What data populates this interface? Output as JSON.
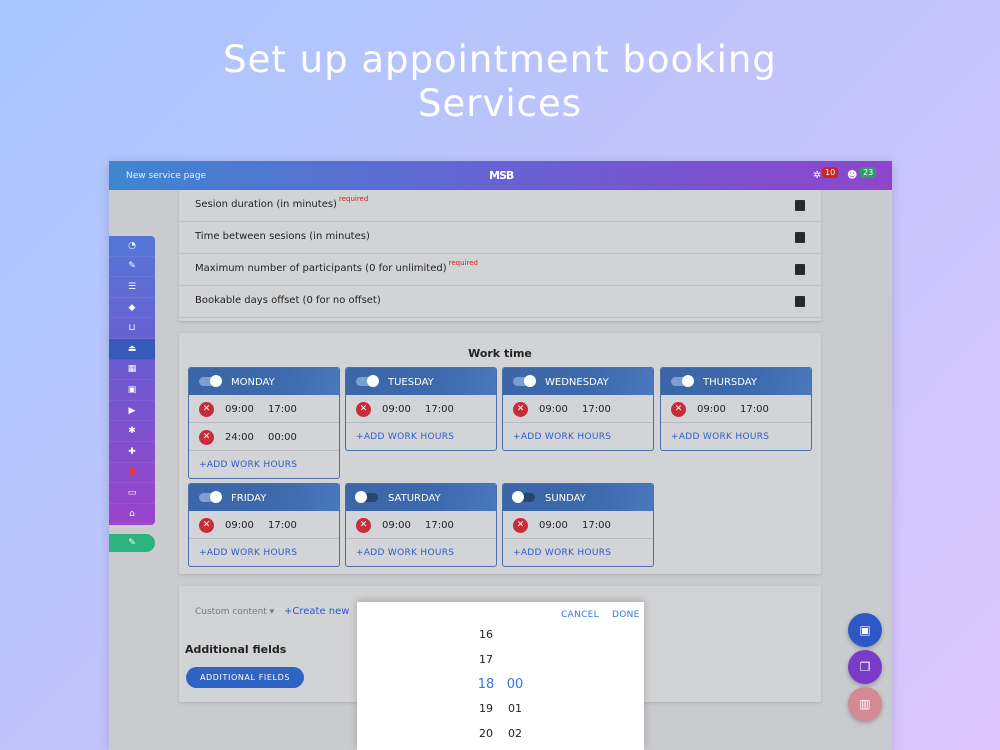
{
  "headline": {
    "line1": "Set up appointment booking",
    "line2": "Services"
  },
  "topbar": {
    "breadcrumb": "New service page",
    "logo": "MSB",
    "notifications_count": "10",
    "users_count": "23"
  },
  "sidebar": {
    "items": [
      {
        "icon": "dashboard-icon",
        "glyph": "◔"
      },
      {
        "icon": "wrench-icon",
        "glyph": "✎"
      },
      {
        "icon": "list-icon",
        "glyph": "☰"
      },
      {
        "icon": "box-icon",
        "glyph": "◆"
      },
      {
        "icon": "cart-icon",
        "glyph": "⊔"
      },
      {
        "icon": "service-bell-icon",
        "glyph": "⏏"
      },
      {
        "icon": "calendar-icon",
        "glyph": "▦"
      },
      {
        "icon": "gift-icon",
        "glyph": "▣"
      },
      {
        "icon": "video-icon",
        "glyph": "▶"
      },
      {
        "icon": "gear-icon",
        "glyph": "✱"
      },
      {
        "icon": "add-user-icon",
        "glyph": "✚"
      },
      {
        "icon": "alert-icon",
        "glyph": "●"
      },
      {
        "icon": "card-icon",
        "glyph": "▭"
      },
      {
        "icon": "graduation-cap-icon",
        "glyph": "⌂"
      }
    ],
    "edit_glyph": "✎"
  },
  "fields": [
    {
      "label": "Sesion duration (in minutes)",
      "required": "required"
    },
    {
      "label": "Time between sesions (in minutes)",
      "required": ""
    },
    {
      "label": "Maximum number of participants (0 for unlimited)",
      "required": "required"
    },
    {
      "label": "Bookable days offset (0 for no offset)",
      "required": ""
    }
  ],
  "work_time": {
    "title": "Work time",
    "add_label": "+ADD WORK HOURS",
    "days": [
      {
        "name": "MONDAY",
        "enabled": true,
        "slots": [
          [
            "09:00",
            "17:00"
          ],
          [
            "24:00",
            "00:00"
          ]
        ]
      },
      {
        "name": "TUESDAY",
        "enabled": true,
        "slots": [
          [
            "09:00",
            "17:00"
          ]
        ]
      },
      {
        "name": "WEDNESDAY",
        "enabled": true,
        "slots": [
          [
            "09:00",
            "17:00"
          ]
        ]
      },
      {
        "name": "THURSDAY",
        "enabled": true,
        "slots": [
          [
            "09:00",
            "17:00"
          ]
        ]
      },
      {
        "name": "FRIDAY",
        "enabled": true,
        "slots": [
          [
            "09:00",
            "17:00"
          ]
        ]
      },
      {
        "name": "SATURDAY",
        "enabled": false,
        "slots": [
          [
            "09:00",
            "17:00"
          ]
        ]
      },
      {
        "name": "SUNDAY",
        "enabled": false,
        "slots": [
          [
            "09:00",
            "17:00"
          ]
        ]
      }
    ]
  },
  "custom": {
    "dropdown": "Custom content ▾",
    "create_new": "+Create new",
    "additional_title": "Additional fields",
    "additional_button": "ADDITIONAL FIELDS"
  },
  "picker": {
    "cancel": "CANCEL",
    "done": "DONE",
    "hours": [
      "16",
      "17",
      "18",
      "19",
      "20"
    ],
    "minutes": [
      "",
      "",
      "00",
      "01",
      "02"
    ],
    "selected_index": 2
  },
  "colors": {
    "accent": "#2b7be0",
    "delete": "#c62d3a",
    "header_blue": "#3b66a8"
  }
}
